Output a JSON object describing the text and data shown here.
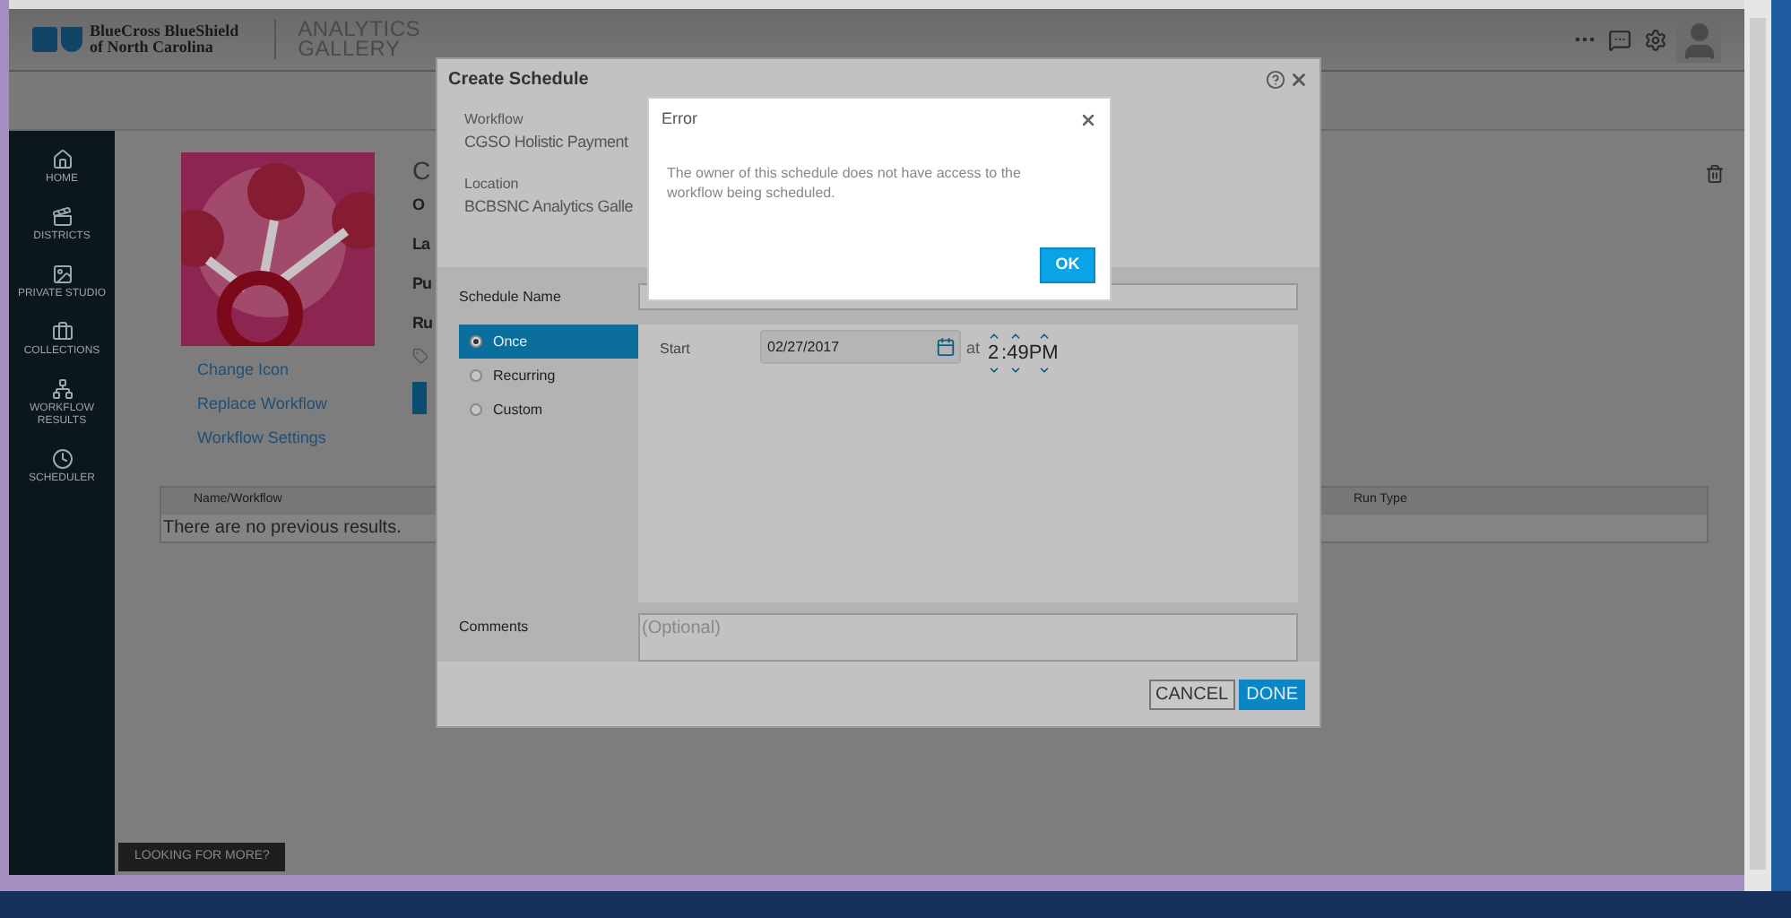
{
  "header": {
    "logo_line1": "BlueCross BlueShield",
    "logo_line2": "of North Carolina",
    "app_title_line1": "ANALYTICS",
    "app_title_line2": "GALLERY"
  },
  "sidebar": {
    "items": [
      {
        "label": "HOME"
      },
      {
        "label": "DISTRICTS"
      },
      {
        "label": "PRIVATE STUDIO"
      },
      {
        "label": "COLLECTIONS"
      },
      {
        "label": "WORKFLOW RESULTS"
      },
      {
        "label": "SCHEDULER"
      }
    ]
  },
  "workflow_page": {
    "links": [
      "Change Icon",
      "Replace Workflow",
      "Workflow Settings"
    ],
    "partial_fields": [
      "O",
      "La",
      "Pu",
      "Ru"
    ],
    "partial_title": "C",
    "table": {
      "columns": [
        "Name/Workflow",
        "Run Type"
      ],
      "empty_message": "There are no previous results."
    }
  },
  "looking_for_more": "LOOKING FOR MORE?",
  "create_schedule": {
    "title": "Create Schedule",
    "workflow_label": "Workflow",
    "workflow_value": "CGSO Holistic Payment",
    "location_label": "Location",
    "location_value": "BCBSNC Analytics Galle",
    "schedule_name_label": "Schedule Name",
    "frequency": [
      {
        "label": "Once",
        "selected": true
      },
      {
        "label": "Recurring",
        "selected": false
      },
      {
        "label": "Custom",
        "selected": false
      }
    ],
    "start_label": "Start",
    "start_date": "02/27/2017",
    "at_label": "at",
    "hour": "2",
    "minute": ":49",
    "ampm": "PM",
    "comments_label": "Comments",
    "comments_placeholder": "(Optional)",
    "buttons": [
      {
        "label": "CANCEL",
        "kind": "secondary"
      },
      {
        "label": "DONE",
        "kind": "primary"
      }
    ]
  },
  "error_dialog": {
    "title": "Error",
    "message": "The owner of this schedule does not have access to the workflow being scheduled.",
    "ok": "OK"
  }
}
